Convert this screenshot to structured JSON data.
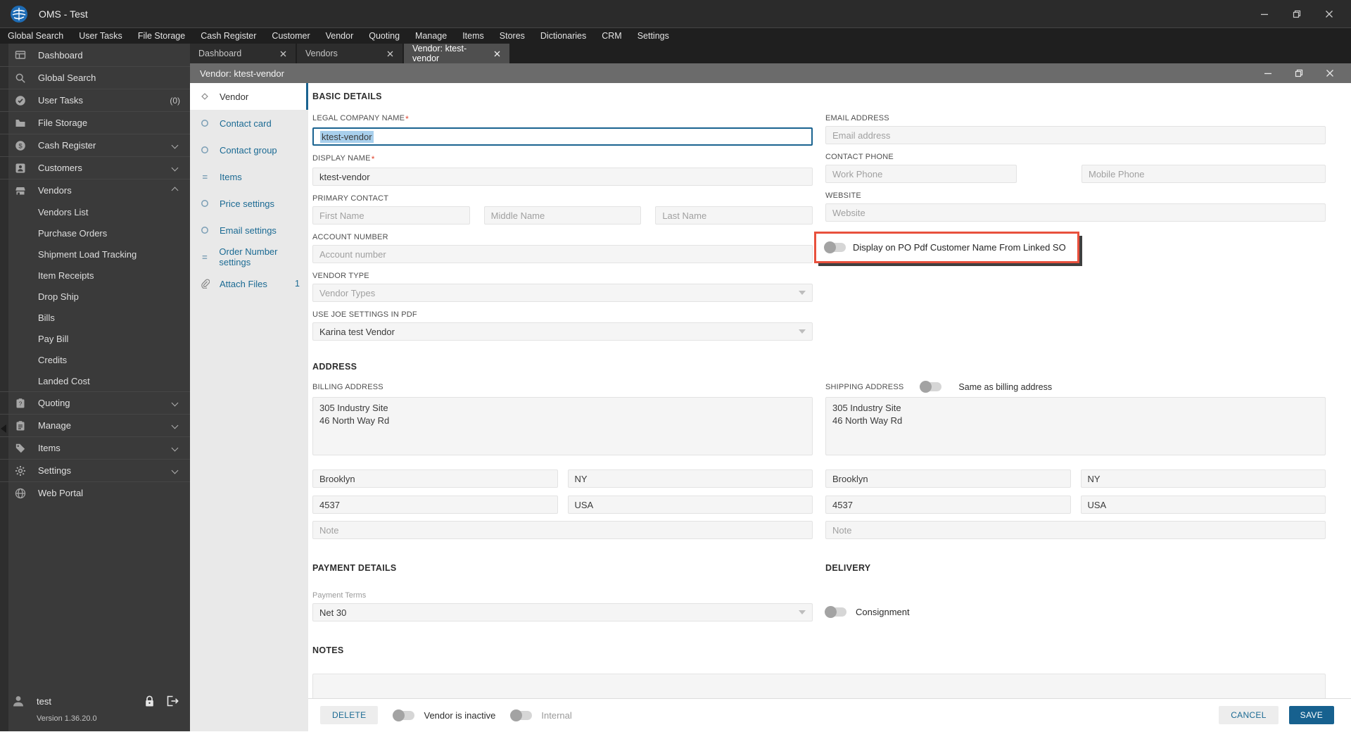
{
  "window": {
    "title": "OMS - Test"
  },
  "menubar": {
    "items": [
      "Global Search",
      "User Tasks",
      "File Storage",
      "Cash Register",
      "Customer",
      "Vendor",
      "Quoting",
      "Manage",
      "Items",
      "Stores",
      "Dictionaries",
      "CRM",
      "Settings"
    ]
  },
  "sidebar": {
    "items": [
      {
        "label": "Dashboard"
      },
      {
        "label": "Global Search"
      },
      {
        "label": "User Tasks",
        "badge": "(0)"
      },
      {
        "label": "File Storage"
      },
      {
        "label": "Cash Register"
      },
      {
        "label": "Customers"
      },
      {
        "label": "Vendors"
      },
      {
        "label": "Vendors List"
      },
      {
        "label": "Purchase Orders"
      },
      {
        "label": "Shipment Load Tracking"
      },
      {
        "label": "Item Receipts"
      },
      {
        "label": "Drop Ship"
      },
      {
        "label": "Bills"
      },
      {
        "label": "Pay Bill"
      },
      {
        "label": "Credits"
      },
      {
        "label": "Landed Cost"
      },
      {
        "label": "Quoting"
      },
      {
        "label": "Manage"
      },
      {
        "label": "Items"
      },
      {
        "label": "Settings"
      },
      {
        "label": "Web Portal"
      }
    ],
    "user": {
      "name": "test",
      "version": "Version 1.36.20.0"
    }
  },
  "tabs": {
    "items": [
      {
        "label": "Dashboard"
      },
      {
        "label": "Vendors"
      },
      {
        "label": "Vendor: ktest-vendor"
      }
    ]
  },
  "inner_window": {
    "title": "Vendor: ktest-vendor"
  },
  "form_nav": {
    "items": [
      {
        "label": "Vendor"
      },
      {
        "label": "Contact card"
      },
      {
        "label": "Contact group"
      },
      {
        "label": "Items"
      },
      {
        "label": "Price settings"
      },
      {
        "label": "Email settings"
      },
      {
        "label": "Order Number settings"
      },
      {
        "label": "Attach Files",
        "badge": "1"
      }
    ]
  },
  "basic": {
    "title": "BASIC DETAILS",
    "legal_name": {
      "label": "LEGAL COMPANY NAME",
      "value": "ktest-vendor"
    },
    "display_name": {
      "label": "DISPLAY NAME",
      "value": "ktest-vendor"
    },
    "primary_contact": {
      "label": "PRIMARY CONTACT",
      "first": "First Name",
      "middle": "Middle Name",
      "last": "Last Name"
    },
    "account_number": {
      "label": "ACCOUNT NUMBER",
      "placeholder": "Account number"
    },
    "vendor_type": {
      "label": "VENDOR TYPE",
      "placeholder": "Vendor Types"
    },
    "joe_settings": {
      "label": "USE JOE SETTINGS IN PDF",
      "value": "Karina test Vendor"
    },
    "email": {
      "label": "EMAIL ADDRESS",
      "placeholder": "Email address"
    },
    "phone": {
      "label": "CONTACT PHONE",
      "work": "Work Phone",
      "mobile": "Mobile Phone"
    },
    "website": {
      "label": "WEBSITE",
      "placeholder": "Website"
    },
    "po_pdf_toggle": {
      "label": "Display on PO Pdf Customer Name From Linked SO"
    }
  },
  "address": {
    "title": "ADDRESS",
    "billing": {
      "label": "BILLING ADDRESS",
      "street": "305 Industry Site\n46 North Way Rd",
      "city": "Brooklyn",
      "state": "NY",
      "zip": "4537",
      "country": "USA",
      "note": "Note"
    },
    "shipping": {
      "label": "SHIPPING ADDRESS",
      "same_toggle": "Same as billing address",
      "street": "305 Industry Site\n46 North Way Rd",
      "city": "Brooklyn",
      "state": "NY",
      "zip": "4537",
      "country": "USA",
      "note": "Note"
    }
  },
  "payment": {
    "title": "PAYMENT DETAILS",
    "terms_label": "Payment Terms",
    "terms_value": "Net 30"
  },
  "delivery": {
    "title": "DELIVERY",
    "consignment": "Consignment"
  },
  "notes": {
    "title": "NOTES"
  },
  "footer": {
    "delete": "DELETE",
    "inactive": "Vendor is inactive",
    "internal": "Internal",
    "cancel": "CANCEL",
    "save": "SAVE"
  },
  "colors": {
    "accent": "#17638f",
    "highlight": "#e8513d"
  }
}
